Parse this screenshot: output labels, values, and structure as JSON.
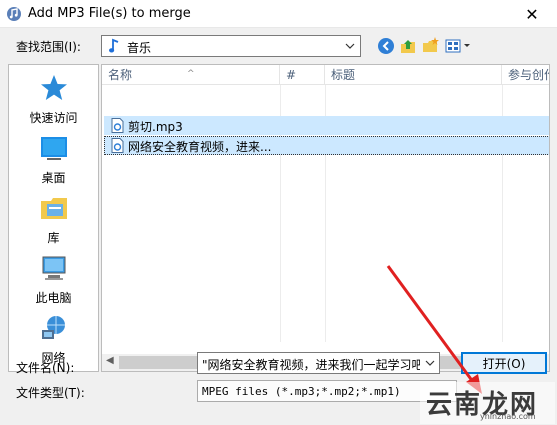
{
  "window": {
    "title": "Add MP3 File(s) to merge",
    "close_glyph": "✕"
  },
  "look_in": {
    "label": "查找范围(I):",
    "value": "音乐"
  },
  "toolbar": {
    "icons": [
      "back-icon",
      "up-folder-icon",
      "new-folder-icon",
      "view-menu-icon"
    ]
  },
  "places": [
    {
      "label": "快速访问",
      "icon": "star-icon"
    },
    {
      "label": "桌面",
      "icon": "desktop-icon"
    },
    {
      "label": "库",
      "icon": "library-icon"
    },
    {
      "label": "此电脑",
      "icon": "computer-icon"
    },
    {
      "label": "网络",
      "icon": "network-icon"
    }
  ],
  "file_list": {
    "columns": [
      "名称",
      "#",
      "标题",
      "参与创作"
    ],
    "rows": [
      {
        "name": "剪切.mp3",
        "selected": true,
        "focused": false
      },
      {
        "name": "网络安全教育视频，进来...",
        "selected": true,
        "focused": true
      }
    ]
  },
  "file_name": {
    "label": "文件名(N):",
    "value": "\"网络安全教育视频，进来我们一起学习吧"
  },
  "file_type": {
    "label": "文件类型(T):",
    "value": "MPEG files (*.mp3;*.mp2;*.mp1)"
  },
  "open_button": {
    "label": "打开(O)"
  },
  "watermark": {
    "text": "云南龙网",
    "url": "ynlnzhao.com"
  },
  "colors": {
    "accent": "#0078d7",
    "selection": "#cce8ff",
    "arrow": "#e02020"
  }
}
